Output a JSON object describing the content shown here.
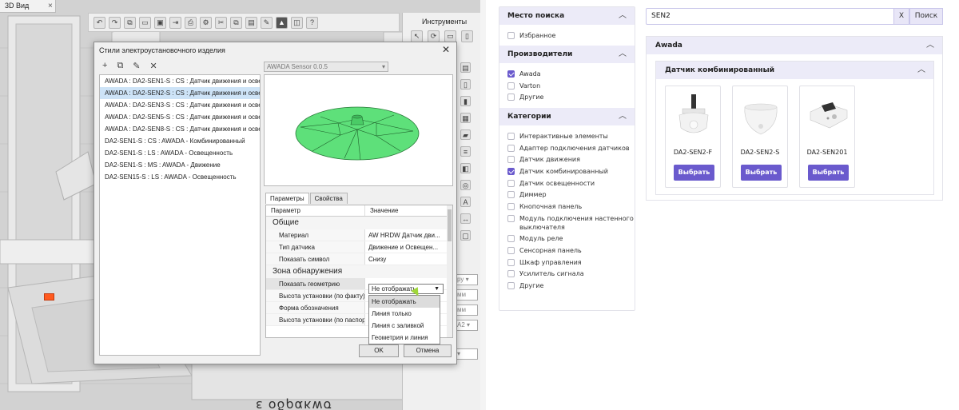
{
  "cad": {
    "tab_label": "3D Вид",
    "tab_close": "×",
    "tools_title": "Инструменты",
    "side_fields": [
      "ру ▾",
      "мм",
      "мм",
      "A2 ▾",
      "▾"
    ],
    "bottom_text": "ε οδρακwσ",
    "dialog": {
      "title": "Стили электроустановочного изделия",
      "close": "✕",
      "tool_icons": [
        "+",
        "⧉",
        "✎",
        "✕"
      ],
      "items": [
        "AWADA : DA2-SEN1-S : CS : Датчик движения и освещенн",
        "AWADA : DA2-SEN2-S : CS : Датчик движения и освещенн",
        "AWADA : DA2-SEN3-S : CS : Датчик движения и освещенн",
        "AWADA : DA2-SEN5-S : CS : Датчик движения и освещенн",
        "AWADA : DA2-SEN8-S : CS : Датчик движения и освещенн",
        "DA2-SEN1-S : CS : AWADA - Комбинированный",
        "DA2-SEN1-S : LS : AWADA - Освещенность",
        "DA2-SEN1-S : MS : AWADA - Движение",
        "DA2-SEN15-S : LS : AWADA - Освещенность"
      ],
      "selected_index": 1,
      "combo_value": "AWADA Sensor 0.0.5",
      "tabs": [
        "Параметры",
        "Свойства"
      ],
      "params_header": {
        "param": "Параметр",
        "value": "Значение"
      },
      "group_general": "Общие",
      "rows_general": [
        {
          "name": "Материал",
          "value": "AW HRDW Датчик дви..."
        },
        {
          "name": "Тип датчика",
          "value": "Движение и Освещен..."
        },
        {
          "name": "Показать символ",
          "value": "Снизу"
        }
      ],
      "group_zone": "Зона обнаружения",
      "rows_zone": [
        {
          "name": "Показать геометрию",
          "value": ""
        },
        {
          "name": "Высота установки (по факту)",
          "value": ""
        },
        {
          "name": "Форма обозначения",
          "value": ""
        },
        {
          "name": "Высота установки (по паспорту)",
          "value": ""
        }
      ],
      "geometry_select": "Не отображать",
      "geometry_options": [
        "Не отображать",
        "Линия только",
        "Линия с заливкой",
        "Геометрия и линия"
      ],
      "ok": "OK",
      "cancel": "Отмена"
    }
  },
  "web": {
    "search_value": "SEN2",
    "clear_label": "X",
    "search_label": "Поиск",
    "filters": {
      "location": {
        "title": "Место поиска",
        "items": [
          {
            "label": "Избранное",
            "checked": false
          }
        ]
      },
      "manufacturers": {
        "title": "Производители",
        "items": [
          {
            "label": "Awada",
            "checked": true
          },
          {
            "label": "Varton",
            "checked": false
          },
          {
            "label": "Другие",
            "checked": false
          }
        ]
      },
      "categories": {
        "title": "Категории",
        "items": [
          {
            "label": "Интерактивные элементы",
            "checked": false
          },
          {
            "label": "Адаптер подключения датчиков",
            "checked": false
          },
          {
            "label": "Датчик движения",
            "checked": false
          },
          {
            "label": "Датчик комбинированный",
            "checked": true
          },
          {
            "label": "Датчик освещенности",
            "checked": false
          },
          {
            "label": "Диммер",
            "checked": false
          },
          {
            "label": "Кнопочная панель",
            "checked": false
          },
          {
            "label": "Модуль подключения настенного выключателя",
            "checked": false
          },
          {
            "label": "Модуль реле",
            "checked": false
          },
          {
            "label": "Сенсорная панель",
            "checked": false
          },
          {
            "label": "Шкаф управления",
            "checked": false
          },
          {
            "label": "Усилитель сигнала",
            "checked": false
          },
          {
            "label": "Другие",
            "checked": false
          }
        ]
      }
    },
    "results": {
      "manufacturer": "Awada",
      "category": "Датчик комбинированный",
      "products": [
        {
          "name": "DA2-SEN2-F",
          "button": "Выбрать"
        },
        {
          "name": "DA2-SEN2-S",
          "button": "Выбрать"
        },
        {
          "name": "DA2-SEN201",
          "button": "Выбрать"
        }
      ]
    },
    "accent_color": "#6a5acd",
    "header_bg": "#ecebf8"
  }
}
